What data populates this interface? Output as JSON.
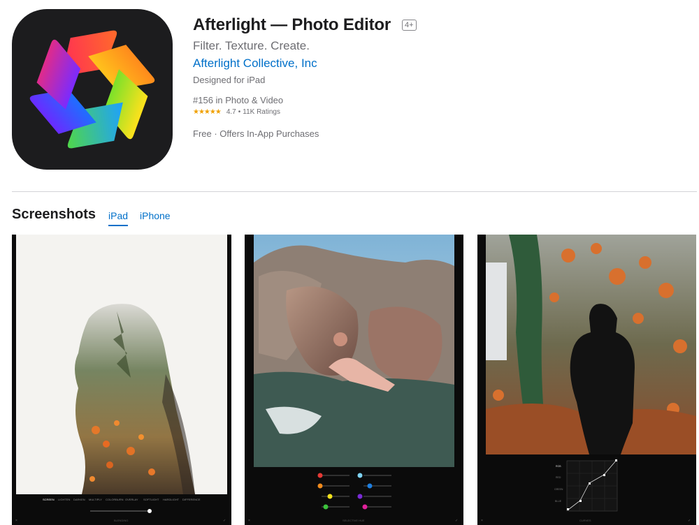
{
  "app": {
    "title": "Afterlight — Photo Editor",
    "age_rating": "4+",
    "subtitle": "Filter. Texture. Create.",
    "developer": "Afterlight Collective, Inc",
    "designed_for": "Designed for iPad",
    "rank": "#156 in Photo & Video",
    "stars": "★★★★★",
    "rating": "4.7",
    "rating_sep": "•",
    "ratings_count": "11K Ratings",
    "price": "Free · Offers In-App Purchases"
  },
  "screenshots": {
    "heading": "Screenshots",
    "tabs": [
      "iPad",
      "iPhone"
    ],
    "active_tab": "iPad",
    "items": [
      {
        "name": "double-exposure-portrait",
        "caption": "BLENDING"
      },
      {
        "name": "rocky-landscape-selective-hue",
        "caption": "SELECTIVE HUE"
      },
      {
        "name": "autumn-forest-curves",
        "caption": "CURVES"
      }
    ],
    "shot1_modes": [
      "SCREEN",
      "LIGHTEN",
      "DARKEN",
      "MULTIPLY",
      "COLORBURN",
      "OVERLAY",
      "SOFTLIGHT",
      "HARDLIGHT",
      "DIFFERENCE"
    ],
    "shot3_channels": [
      "RGB",
      "RED",
      "GREEN",
      "BLUE"
    ]
  },
  "colors": {
    "link": "#0070c9",
    "text_secondary": "#6e6e73",
    "star": "#f0a000",
    "icon_bg": "#1c1c1e"
  },
  "icons": [
    "afterlight-aperture-logo",
    "star-icon"
  ]
}
